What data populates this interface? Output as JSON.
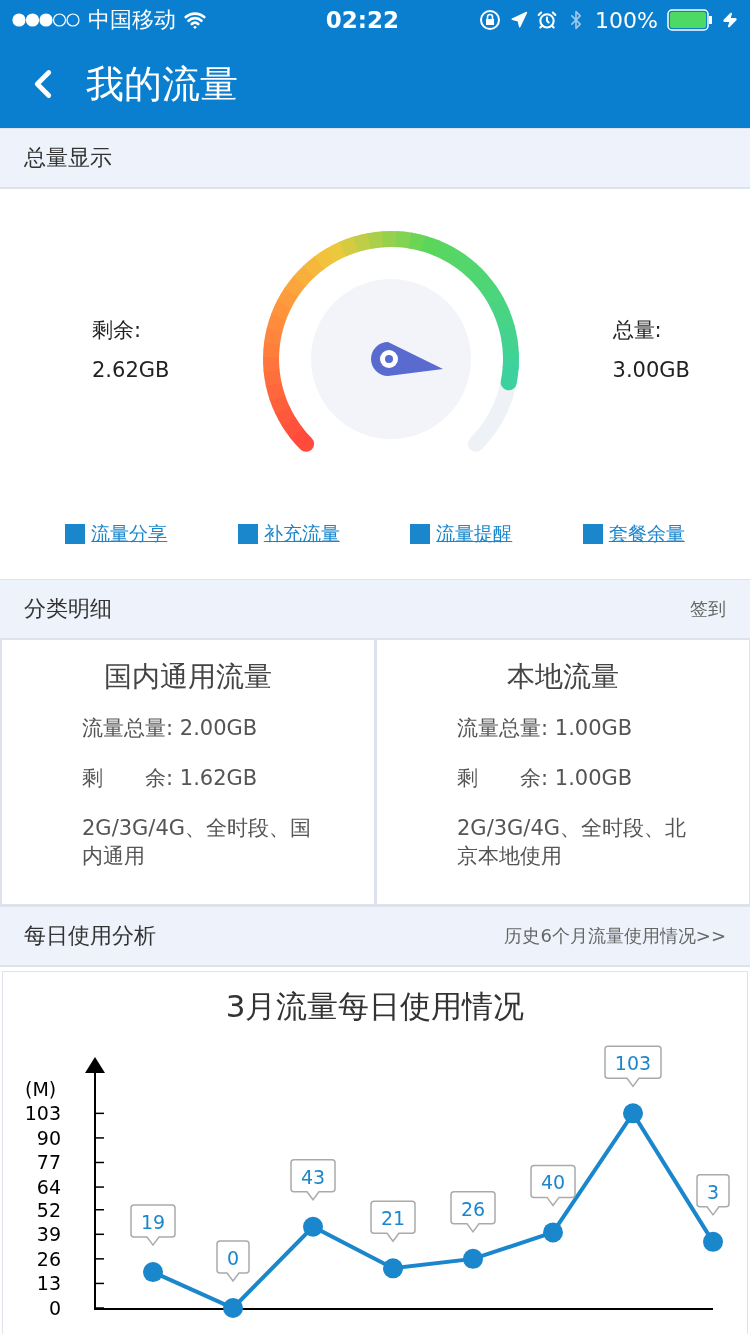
{
  "status_bar": {
    "carrier": "中国移动",
    "time": "02:22",
    "battery": "100%"
  },
  "header": {
    "title": "我的流量"
  },
  "total_section": {
    "title": "总量显示",
    "remaining": {
      "label": "剩余:",
      "value": "2.62GB"
    },
    "total": {
      "label": "总量:",
      "value": "3.00GB"
    },
    "links": [
      "流量分享",
      "补充流量",
      "流量提醒",
      "套餐余量"
    ]
  },
  "detail_section": {
    "title": "分类明细",
    "action": "签到",
    "cards": [
      {
        "title": "国内通用流量",
        "rows": [
          {
            "label": "流量总量:",
            "value": "2.00GB"
          },
          {
            "label": "剩　　余:",
            "value": "1.62GB"
          }
        ],
        "note": "2G/3G/4G、全时段、国内通用"
      },
      {
        "title": "本地流量",
        "rows": [
          {
            "label": "流量总量:",
            "value": "1.00GB"
          },
          {
            "label": "剩　　余:",
            "value": "1.00GB"
          }
        ],
        "note": "2G/3G/4G、全时段、北京本地使用"
      }
    ]
  },
  "daily_section": {
    "title": "每日使用分析",
    "action": "历史6个月流量使用情况>>",
    "chart_data": {
      "type": "line",
      "title": "3月流量每日使用情况",
      "ylabel": "(M)",
      "series": [
        {
          "color": "#1a86cc",
          "marker": "circle",
          "values": [
            19,
            0,
            43,
            21,
            26,
            40,
            103,
            35
          ]
        }
      ],
      "ylim": [
        0,
        127
      ],
      "yticks": [
        0,
        13,
        26,
        39,
        52,
        64,
        77,
        90,
        103
      ],
      "value_labels": [
        "19",
        "0",
        "43",
        "21",
        "26",
        "40",
        "103",
        "3"
      ]
    }
  }
}
